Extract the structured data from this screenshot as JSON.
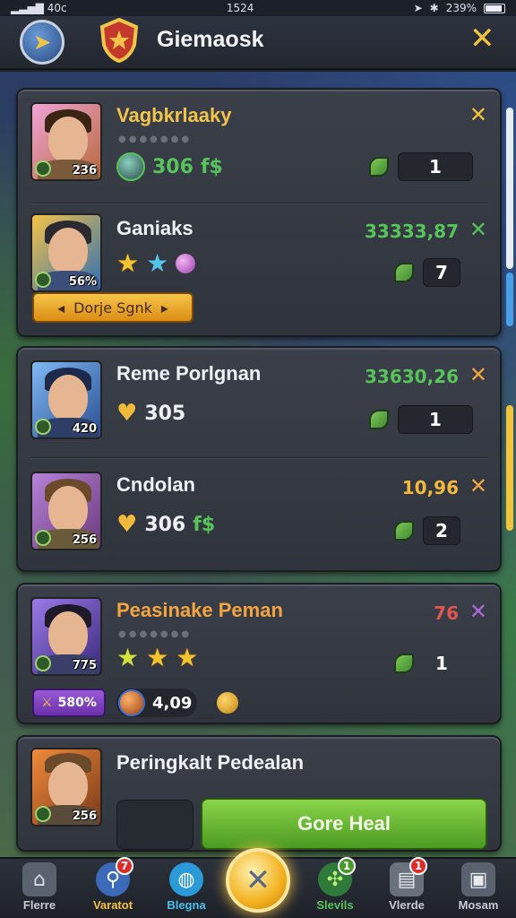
{
  "status_bar": {
    "carrier": "40c",
    "time": "1524",
    "battery": "239%"
  },
  "header": {
    "title": "Giemaosk"
  },
  "entries": [
    {
      "name": "Vagbkrlaaky",
      "stat": "306",
      "stat_suffix": "f$",
      "count": "1",
      "level": "236"
    },
    {
      "name": "Ganiaks",
      "value": "33333,87",
      "count": "7",
      "level": "56%",
      "button": "Dorje Sgnk"
    },
    {
      "name": "Reme Porlgnan",
      "value": "33630,26",
      "stat": "305",
      "count": "1",
      "level": "420"
    },
    {
      "name": "Cndolan",
      "value": "10,96",
      "stat": "306",
      "stat_suffix": "f$",
      "count": "2",
      "level": "256"
    },
    {
      "name": "Peasinake Peman",
      "value": "76",
      "count": "1",
      "level": "775",
      "xp": "580%",
      "orb": "4,09"
    },
    {
      "name": "Peringkalt Pedealan",
      "level": "256",
      "button": "Gore Heal"
    }
  ],
  "nav": [
    {
      "label": "Flerre",
      "icon": "home-icon"
    },
    {
      "label": "Varatot",
      "icon": "search-icon",
      "badge": "7"
    },
    {
      "label": "Blegna",
      "icon": "globe-icon"
    },
    {
      "label": "Slevils",
      "icon": "skills-icon",
      "badge": "1"
    },
    {
      "label": "Vlerde",
      "icon": "scroll-icon",
      "badge": "1"
    },
    {
      "label": "Mosam",
      "icon": "box-icon"
    }
  ],
  "colors": {
    "accent_gold": "#f2c54a",
    "green_value": "#57c45a",
    "orange_value": "#f3a43f",
    "red_value": "#e0564f"
  }
}
